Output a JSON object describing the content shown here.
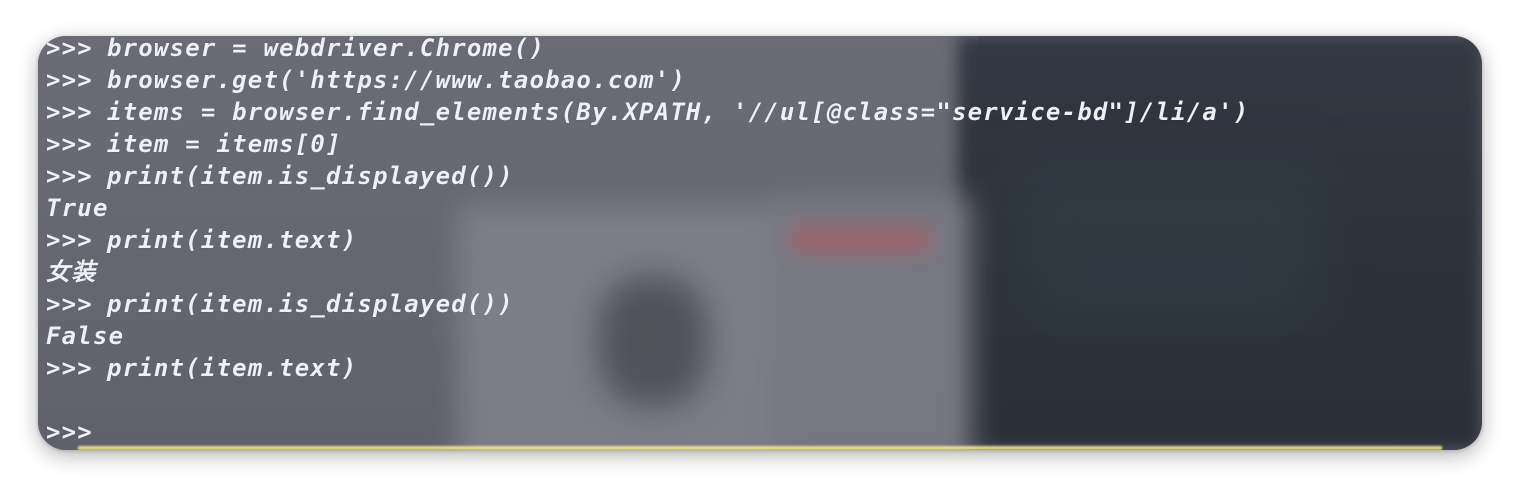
{
  "terminal": {
    "prompt": ">>>",
    "lines": [
      {
        "type": "input",
        "text": "browser = webdriver.Chrome()"
      },
      {
        "type": "input",
        "text": "browser.get('https://www.taobao.com')"
      },
      {
        "type": "input",
        "text": "items = browser.find_elements(By.XPATH, '//ul[@class=\"service-bd\"]/li/a')"
      },
      {
        "type": "input",
        "text": "item = items[0]"
      },
      {
        "type": "input",
        "text": "print(item.is_displayed())"
      },
      {
        "type": "output",
        "text": "True"
      },
      {
        "type": "input",
        "text": "print(item.text)"
      },
      {
        "type": "output",
        "text": "女装"
      },
      {
        "type": "input",
        "text": "print(item.is_displayed())"
      },
      {
        "type": "output",
        "text": "False"
      },
      {
        "type": "input",
        "text": "print(item.text)"
      },
      {
        "type": "output",
        "text": ""
      },
      {
        "type": "input",
        "text": ""
      }
    ]
  }
}
